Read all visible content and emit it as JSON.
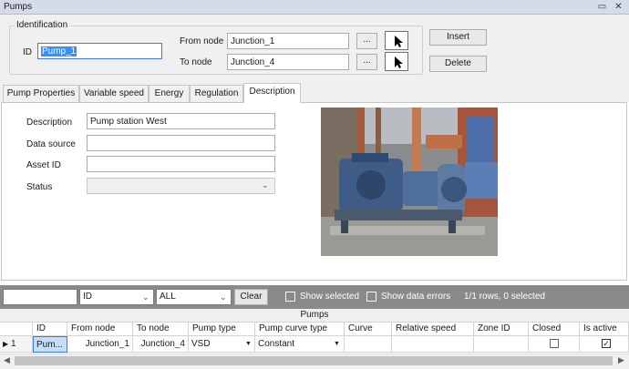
{
  "window": {
    "title": "Pumps"
  },
  "identification": {
    "legend": "Identification",
    "id_label": "ID",
    "id_value": "Pump_1",
    "from_node_label": "From node",
    "from_node_value": "Junction_1",
    "to_node_label": "To node",
    "to_node_value": "Junction_4",
    "browse_label": "...",
    "insert_label": "Insert",
    "delete_label": "Delete"
  },
  "tabs": [
    {
      "label": "Pump Properties"
    },
    {
      "label": "Variable speed"
    },
    {
      "label": "Energy"
    },
    {
      "label": "Regulation"
    },
    {
      "label": "Description"
    }
  ],
  "active_tab": "Description",
  "description_form": {
    "description_label": "Description",
    "description_value": "Pump station West",
    "data_source_label": "Data source",
    "data_source_value": "",
    "asset_id_label": "Asset ID",
    "asset_id_value": "",
    "status_label": "Status",
    "status_value": ""
  },
  "filterbar": {
    "search_value": "",
    "field_select": "ID",
    "filter_select": "ALL",
    "clear_label": "Clear",
    "show_selected_label": "Show selected",
    "show_data_errors_label": "Show data errors",
    "row_status": "1/1 rows, 0 selected"
  },
  "grid": {
    "title": "Pumps",
    "columns": [
      "ID",
      "From node",
      "To node",
      "Pump type",
      "Pump curve type",
      "Curve",
      "Relative speed",
      "Zone ID",
      "Closed",
      "Is active"
    ],
    "rows": [
      {
        "index": "1",
        "id": "Pum...",
        "from_node": "Junction_1",
        "to_node": "Junction_4",
        "pump_type": "VSD",
        "pump_curve_type": "Constant",
        "curve": "",
        "relative_speed": "",
        "zone_id": "",
        "closed": false,
        "is_active": true
      }
    ]
  },
  "colors": {
    "titlebar": "#d6dbe9",
    "filterbar": "#8a8a8a",
    "selection": "#3390ff",
    "id_cell": "#c6dcf7"
  }
}
